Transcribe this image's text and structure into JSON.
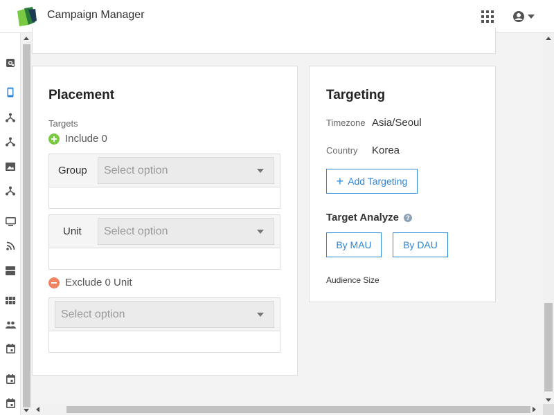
{
  "header": {
    "app_title": "Campaign Manager",
    "icons": [
      "logo-icon",
      "apps-grid-icon",
      "user-account-icon",
      "caret-down-icon"
    ]
  },
  "sidebar": {
    "icons": [
      "search-report-icon",
      "mobile-icon",
      "network-icon",
      "network-icon",
      "image-icon",
      "network-icon",
      "monitor-icon",
      "rss-icon",
      "server-icon",
      "grid-icon",
      "people-icon",
      "calendar-icon",
      "calendar-icon",
      "calendar-icon"
    ],
    "active_color": "#2e86d6"
  },
  "placement": {
    "title": "Placement",
    "targets_label": "Targets",
    "include_label": "Include 0",
    "group_label": "Group",
    "group_placeholder": "Select option",
    "unit_label": "Unit",
    "unit_placeholder": "Select option",
    "exclude_label": "Exclude 0 Unit",
    "exclude_placeholder": "Select option"
  },
  "targeting": {
    "title": "Targeting",
    "timezone_label": "Timezone",
    "timezone_value": "Asia/Seoul",
    "country_label": "Country",
    "country_value": "Korea",
    "add_button": "Add Targeting",
    "analyze_title": "Target Analyze",
    "by_mau": "By MAU",
    "by_dau": "By DAU",
    "audience_size_label": "Audience Size"
  },
  "colors": {
    "accent": "#2e86d6",
    "include_green": "#7ac943",
    "exclude_red": "#f08460"
  }
}
